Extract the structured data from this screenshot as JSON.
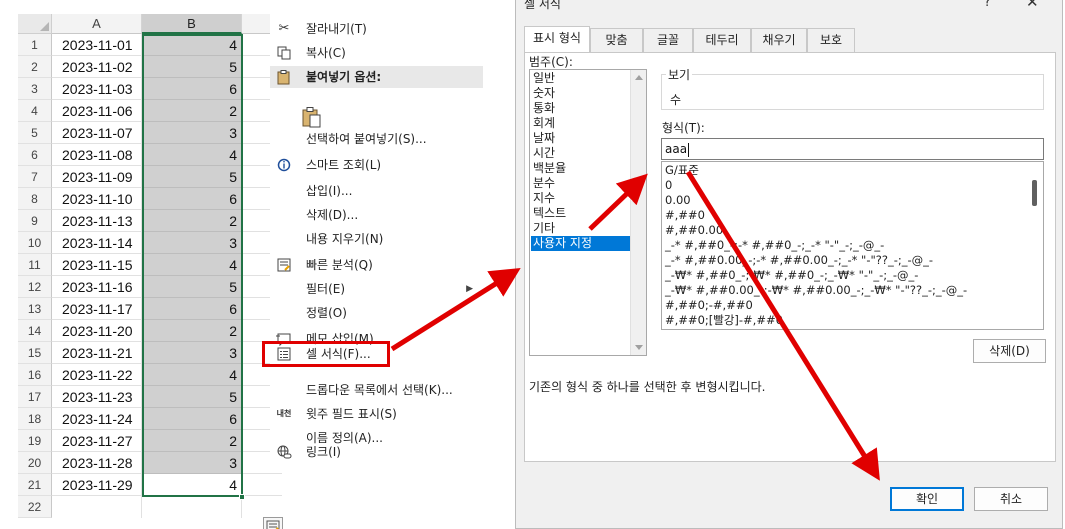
{
  "sheet": {
    "col_a": "A",
    "col_b": "B",
    "last_row_number": "22",
    "rows": [
      {
        "n": "1",
        "date": "2023-11-01",
        "val": "4"
      },
      {
        "n": "2",
        "date": "2023-11-02",
        "val": "5"
      },
      {
        "n": "3",
        "date": "2023-11-03",
        "val": "6"
      },
      {
        "n": "4",
        "date": "2023-11-06",
        "val": "2"
      },
      {
        "n": "5",
        "date": "2023-11-07",
        "val": "3"
      },
      {
        "n": "6",
        "date": "2023-11-08",
        "val": "4"
      },
      {
        "n": "7",
        "date": "2023-11-09",
        "val": "5"
      },
      {
        "n": "8",
        "date": "2023-11-10",
        "val": "6"
      },
      {
        "n": "9",
        "date": "2023-11-13",
        "val": "2"
      },
      {
        "n": "10",
        "date": "2023-11-14",
        "val": "3"
      },
      {
        "n": "11",
        "date": "2023-11-15",
        "val": "4"
      },
      {
        "n": "12",
        "date": "2023-11-16",
        "val": "5"
      },
      {
        "n": "13",
        "date": "2023-11-17",
        "val": "6"
      },
      {
        "n": "14",
        "date": "2023-11-20",
        "val": "2"
      },
      {
        "n": "15",
        "date": "2023-11-21",
        "val": "3"
      },
      {
        "n": "16",
        "date": "2023-11-22",
        "val": "4"
      },
      {
        "n": "17",
        "date": "2023-11-23",
        "val": "5"
      },
      {
        "n": "18",
        "date": "2023-11-24",
        "val": "6"
      },
      {
        "n": "19",
        "date": "2023-11-27",
        "val": "2"
      },
      {
        "n": "20",
        "date": "2023-11-28",
        "val": "3"
      },
      {
        "n": "21",
        "date": "2023-11-29",
        "val": "4"
      }
    ]
  },
  "menu": {
    "cut": "잘라내기(T)",
    "copy": "복사(C)",
    "paste_options": "붙여넣기 옵션:",
    "paste_special": "선택하여 붙여넣기(S)...",
    "smart_lookup": "스마트 조회(L)",
    "insert": "삽입(I)...",
    "delete": "삭제(D)...",
    "clear_contents": "내용 지우기(N)",
    "quick_analysis": "빠른 분석(Q)",
    "filter": "필터(E)",
    "sort": "정렬(O)",
    "insert_comment": "메모 삽입(M)",
    "format_cells": "셀 서식(F)...",
    "pick_from_dropdown": "드롭다운 목록에서 선택(K)...",
    "phonetic": "윗주 필드 표시(S)",
    "define_name": "이름 정의(A)...",
    "link": "링크(I)",
    "phonetic_icon_text": "내천"
  },
  "dialog": {
    "title": "셀 서식",
    "help": "?",
    "close": "✕",
    "tabs": [
      "표시 형식",
      "맞춤",
      "글꼴",
      "테두리",
      "채우기",
      "보호"
    ],
    "category_label": "범주(C):",
    "categories": [
      "일반",
      "숫자",
      "통화",
      "회계",
      "날짜",
      "시간",
      "백분율",
      "분수",
      "지수",
      "텍스트",
      "기타",
      "사용자 지정"
    ],
    "selected_category": "사용자 지정",
    "preview_label": "보기",
    "preview_value": "수",
    "type_label": "형식(T):",
    "type_value": "aaa",
    "formats": [
      "G/표준",
      "0",
      "0.00",
      "#,##0",
      "#,##0.00",
      "_-* #,##0_-;-* #,##0_-;_-* \"-\"_-;_-@_-",
      "_-* #,##0.00_-;-* #,##0.00_-;_-* \"-\"??_-;_-@_-",
      "_-₩* #,##0_-;-₩* #,##0_-;_-₩* \"-\"_-;_-@_-",
      "_-₩* #,##0.00_-;-₩* #,##0.00_-;_-₩* \"-\"??_-;_-@_-",
      "#,##0;-#,##0",
      "#,##0;[빨강]-#,##0"
    ],
    "delete_button": "삭제(D)",
    "description": "기존의 형식 중 하나를 선택한 후 변형시킵니다.",
    "ok_button": "확인",
    "cancel_button": "취소"
  },
  "colors": {
    "selection_green": "#217346",
    "highlight_red": "#e00000",
    "list_selection_blue": "#0078d7"
  }
}
